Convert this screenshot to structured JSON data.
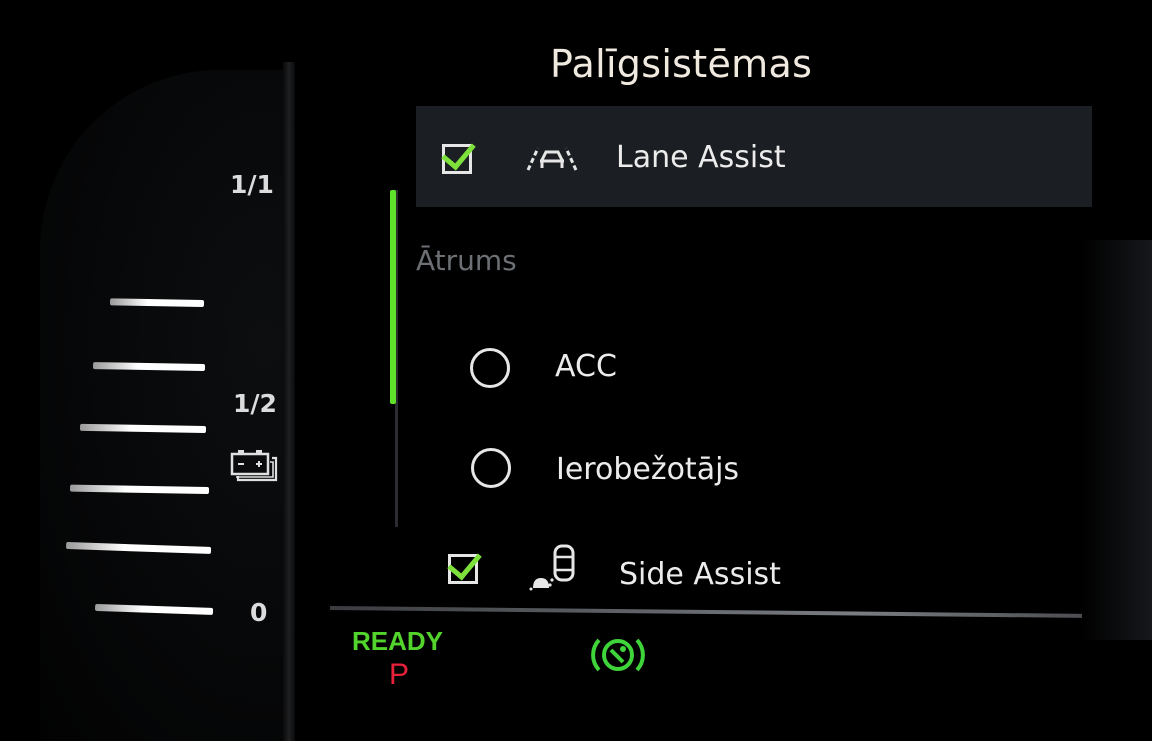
{
  "gauge": {
    "labels": {
      "full": "1/1",
      "half": "1/2",
      "empty": "0"
    },
    "battery_icon": "battery-icon",
    "level_color": "#ffffff"
  },
  "menu": {
    "title": "Palīgsistēmas",
    "items": [
      {
        "label": "Lane Assist",
        "checked": true,
        "icon": "lane-assist-icon",
        "selected": true
      },
      {
        "section": "Ātrums"
      },
      {
        "label": "ACC",
        "type": "radio",
        "selected": false
      },
      {
        "label": "Ierobežotājs",
        "type": "radio",
        "selected": false
      },
      {
        "label": "Side Assist",
        "checked": true,
        "icon": "side-assist-icon"
      }
    ],
    "scroll_fraction": 0.63
  },
  "status": {
    "ready_text": "READY",
    "gear": "P",
    "ready_color": "#52d42c",
    "gear_color": "#e8213a",
    "parking_brake_icon": "parking-brake-icon",
    "parking_brake_color": "#3fd43a"
  },
  "colors": {
    "accent_green": "#7ee03a",
    "selected_row": "#1b1e22"
  }
}
